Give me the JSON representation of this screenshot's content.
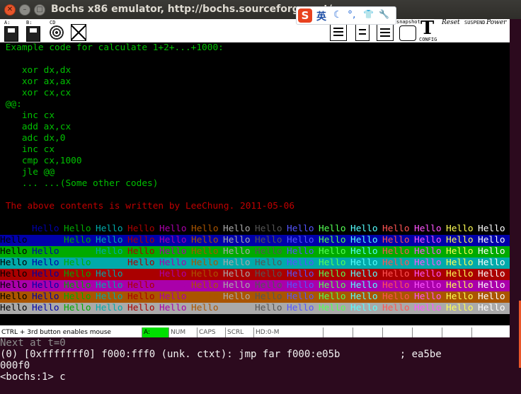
{
  "window": {
    "title": "Bochs x86 emulator, http://bochs.sourceforge.net/",
    "close_glyph": "✕",
    "min_glyph": "–",
    "max_glyph": "□"
  },
  "ime": {
    "logo": "S",
    "mode": "英",
    "icons": [
      "moon-icon",
      "punctuation-icon",
      "shirt-icon",
      "wrench-icon"
    ],
    "glyphs": [
      "☾",
      "°,",
      "👕",
      "🔧"
    ]
  },
  "toolbar": {
    "floppy_a": "A:",
    "floppy_b": "B:",
    "cdrom": "CD",
    "snapshot": "snapshot",
    "config": "CONFIG",
    "reset": "Reset",
    "suspend": "SUSPEND",
    "power": "Power"
  },
  "screen": {
    "lines": [
      {
        "text": " Example code for calculate 1+2+...+1000:",
        "color": "#00c000",
        "row": 0
      },
      {
        "text": "    xor dx,dx",
        "color": "#00c000",
        "row": 2
      },
      {
        "text": "    xor ax,ax",
        "color": "#00c000",
        "row": 3
      },
      {
        "text": "    xor cx,cx",
        "color": "#00c000",
        "row": 4
      },
      {
        "text": " @@:",
        "color": "#00c000",
        "row": 5
      },
      {
        "text": "    inc cx",
        "color": "#00c000",
        "row": 6
      },
      {
        "text": "    add ax,cx",
        "color": "#00c000",
        "row": 7
      },
      {
        "text": "    adc dx,0",
        "color": "#00c000",
        "row": 8
      },
      {
        "text": "    inc cx",
        "color": "#00c000",
        "row": 9
      },
      {
        "text": "    cmp cx,1000",
        "color": "#00c000",
        "row": 10
      },
      {
        "text": "    jle @@",
        "color": "#00c000",
        "row": 11
      },
      {
        "text": "    ... ...(Some other codes)",
        "color": "#00c000",
        "row": 12
      },
      {
        "text": " The above contents is written by LeeChung. 2011-05-06",
        "color": "#c00000",
        "row": 14
      }
    ],
    "hello_word": "Hello",
    "palette": [
      "#000000",
      "#0000aa",
      "#00aa00",
      "#00aaaa",
      "#aa0000",
      "#aa00aa",
      "#aa5500",
      "#aaaaaa",
      "#555555",
      "#5555ff",
      "#55ff55",
      "#55ffff",
      "#ff5555",
      "#ff55ff",
      "#ffff55",
      "#ffffff"
    ]
  },
  "statusbar": {
    "message": "CTRL + 3rd button enables mouse",
    "fields": [
      "A:",
      "NUM",
      "CAPS",
      "SCRL",
      "HD:0-M"
    ]
  },
  "terminal": {
    "next": "Next at t=0",
    "instr": "(0) [0xfffffff0] f000:fff0 (unk. ctxt): jmp far f000:e05b          ; ea5be",
    "instr_cont": "000f0",
    "prompt": "<bochs:1> c"
  }
}
